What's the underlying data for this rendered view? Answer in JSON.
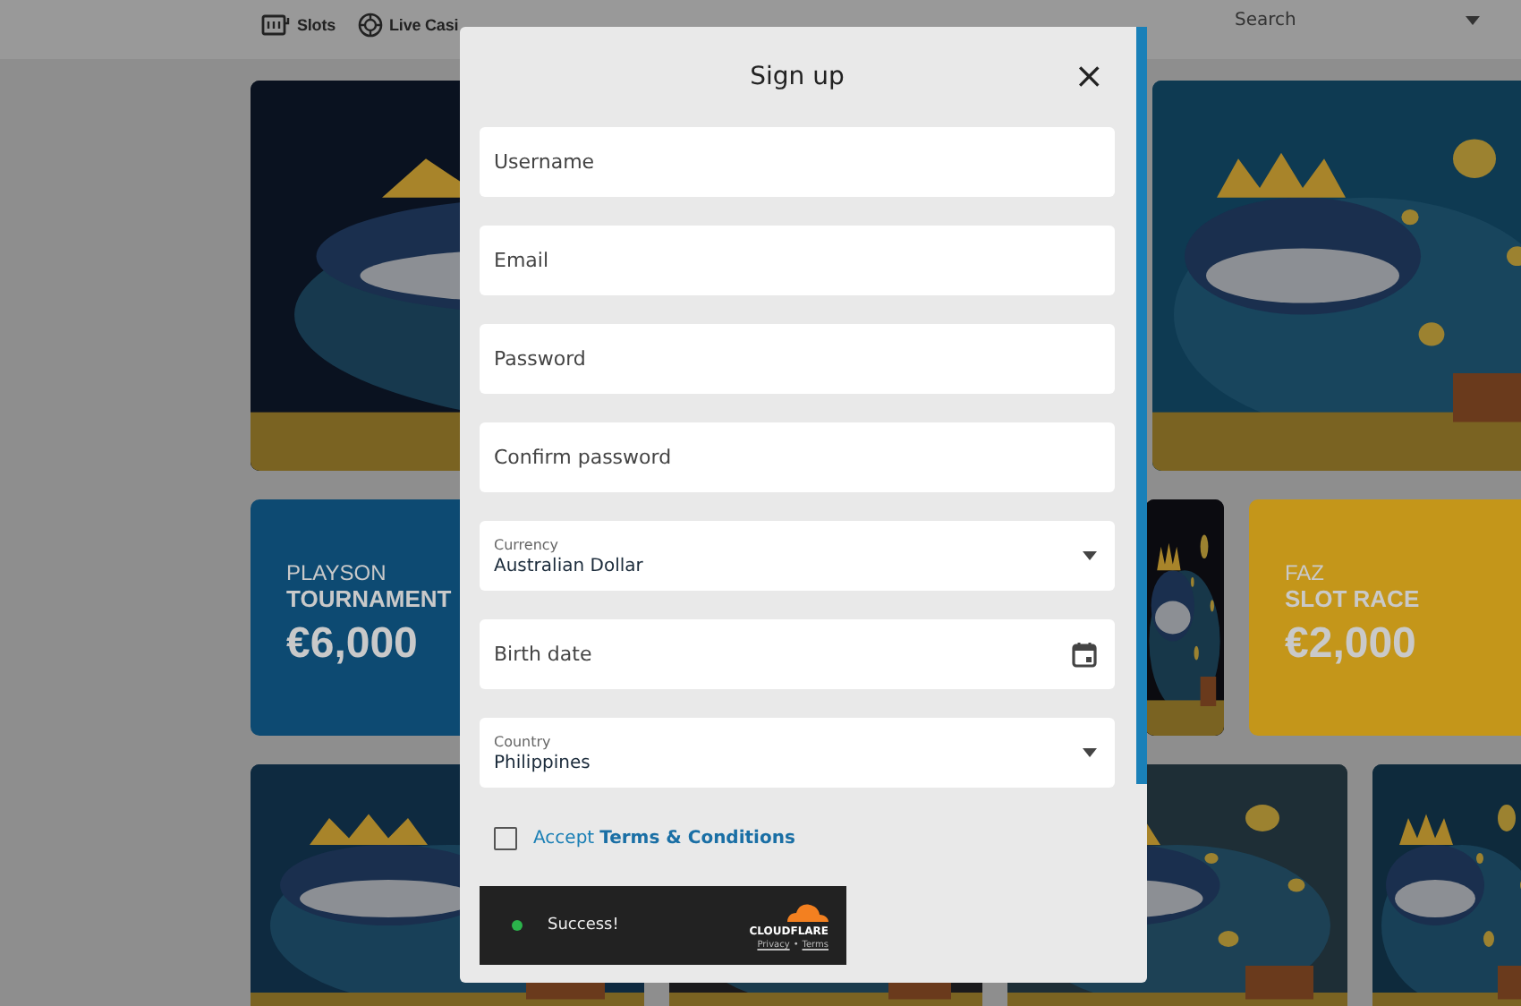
{
  "nav": {
    "items": [
      {
        "label": "Slots"
      },
      {
        "label": "Live Casi"
      }
    ],
    "search": {
      "placeholder": "Search"
    }
  },
  "rows": [
    [
      {
        "kind": "picture"
      },
      {
        "kind": "picture"
      }
    ],
    [
      {
        "kind": "promo",
        "color": "#0d4a72",
        "lines": [
          "PLAYSON",
          "TOURNAMENT",
          "€6,000"
        ]
      },
      {
        "kind": "picture"
      },
      {
        "kind": "promo",
        "color": "#c4961a",
        "lines": [
          "FAZ",
          "SLOT RACE",
          "€2,000"
        ]
      }
    ],
    [
      {
        "kind": "picture"
      },
      {
        "kind": "picture"
      },
      {
        "kind": "picture"
      },
      {
        "kind": "picture"
      }
    ]
  ],
  "modal": {
    "title": "Sign up",
    "close": "×",
    "fields": [
      {
        "kind": "text",
        "placeholder": "Username"
      },
      {
        "kind": "text",
        "placeholder": "Email"
      },
      {
        "kind": "text",
        "placeholder": "Password"
      },
      {
        "kind": "text",
        "placeholder": "Confirm password"
      },
      {
        "kind": "select",
        "label": "Currency",
        "value": "Australian Dollar"
      },
      {
        "kind": "date",
        "placeholder": "Birth date"
      },
      {
        "kind": "select",
        "label": "Country",
        "value": "Philippines"
      }
    ],
    "terms": {
      "checked": false,
      "prefix": "Accept",
      "link": "Terms & Conditions"
    },
    "captcha": {
      "status": "Success!",
      "brand": "CLOUDFLARE",
      "links": [
        "Privacy",
        "•",
        "Terms"
      ]
    }
  }
}
